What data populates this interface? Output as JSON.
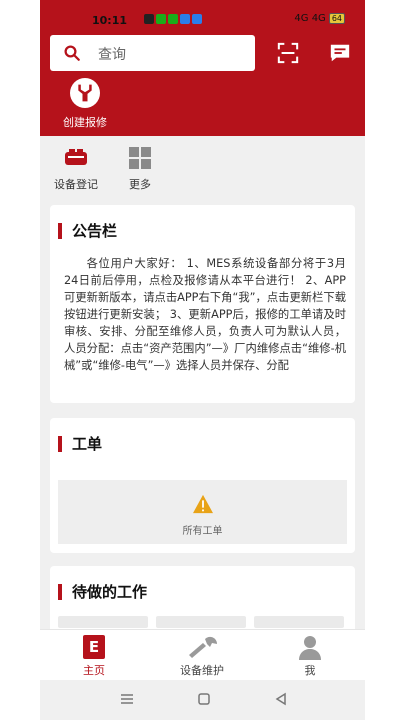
{
  "status_bar": {
    "time": "10:11",
    "network": "4G 4G",
    "battery": "64"
  },
  "search": {
    "placeholder": "查询"
  },
  "header": {
    "quick_action": {
      "label": "创建报修",
      "icon": "wrench-icon"
    }
  },
  "apps": [
    {
      "label": "设备登记",
      "icon": "equipment-icon"
    },
    {
      "label": "更多",
      "icon": "grid-icon"
    }
  ],
  "notice": {
    "title": "公告栏",
    "text": "各位用户大家好： 1、MES系统设备部分将于3月24日前后停用，点检及报修请从本平台进行！ 2、APP可更新新版本，请点击APP右下角“我”，点击更新栏下载按钮进行更新安装； 3、更新APP后，报修的工单请及时审核、安排、分配至维修人员，负责人可为默认人员，人员分配：点击“资产范围内”—》厂内维修点击“维修-机械”或“维修-电气”—》选择人员并保存、分配"
  },
  "workorder": {
    "title": "工单",
    "empty_label": "所有工单"
  },
  "todo": {
    "title": "待做的工作"
  },
  "tabbar": [
    {
      "label": "主页",
      "icon": "home-e-icon",
      "active": true
    },
    {
      "label": "设备维护",
      "icon": "wrench-icon",
      "active": false
    },
    {
      "label": "我",
      "icon": "user-icon",
      "active": false
    }
  ],
  "colors": {
    "brand": "#b5121b"
  }
}
